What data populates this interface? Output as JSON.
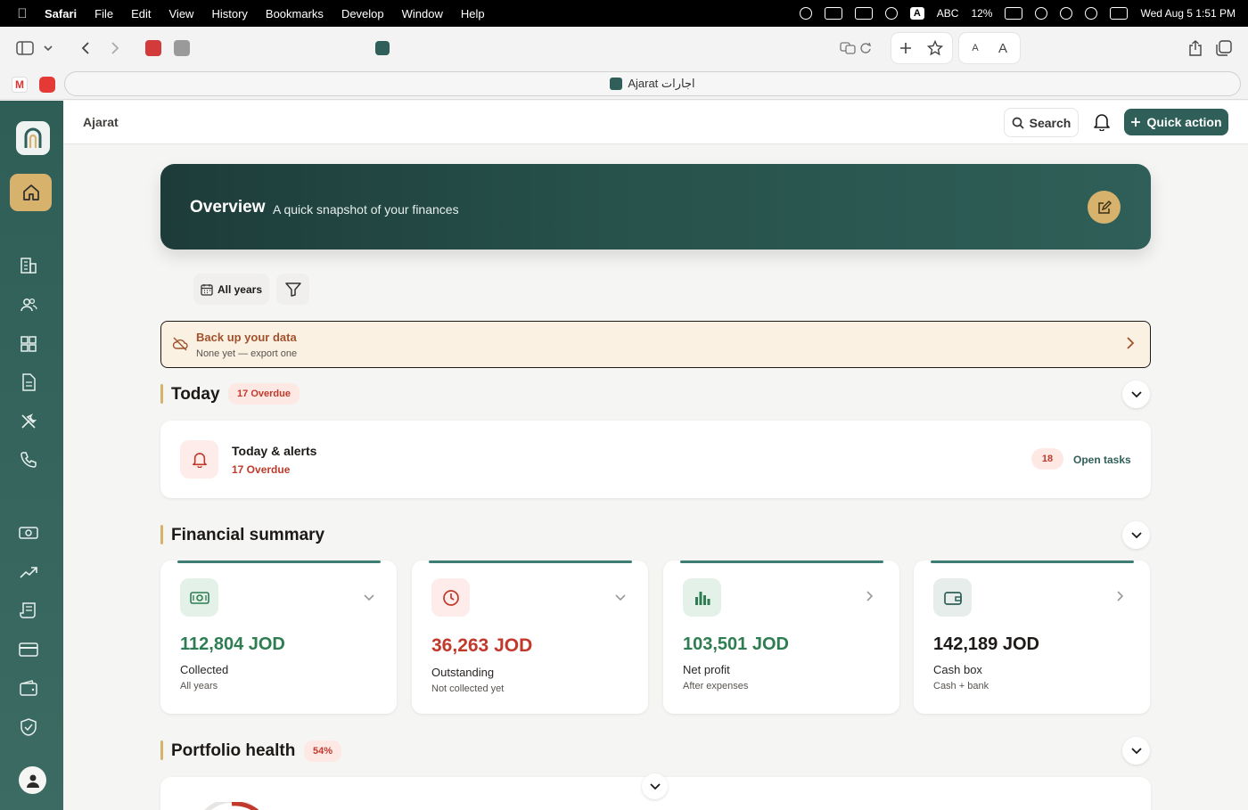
{
  "menubar": {
    "app": "Safari",
    "items": [
      "File",
      "Edit",
      "View",
      "History",
      "Bookmarks",
      "Develop",
      "Window",
      "Help"
    ],
    "input_label": "ABC",
    "battery": "12%",
    "datetime": "Wed Aug 5  1:51 PM"
  },
  "browser": {
    "tab_title": "Ajarat اجارات",
    "text_size_small": "A",
    "text_size_large": "A"
  },
  "app": {
    "brand": "Ajarat",
    "search_label": "Search",
    "quick_action_label": "Quick action",
    "accent": "#2f5f58",
    "gold": "#d6b26c"
  },
  "overview": {
    "title": "Overview",
    "subtitle": "A quick snapshot of your finances"
  },
  "filters": {
    "years_label": "All years"
  },
  "backup": {
    "title": "Back up your data",
    "subtitle": "None yet — export one"
  },
  "today": {
    "title": "Today",
    "badge": "17 Overdue",
    "alerts_title": "Today & alerts",
    "alerts_sub": "17 Overdue",
    "open_count": "18",
    "open_label": "Open tasks"
  },
  "financial": {
    "title": "Financial summary",
    "cards": [
      {
        "value": "112,804 JOD",
        "label": "Collected",
        "sub": "All years",
        "color": "#2e7d52",
        "icon": "money-icon"
      },
      {
        "value": "36,263 JOD",
        "label": "Outstanding",
        "sub": "Not collected yet",
        "color": "#c0392b",
        "icon": "clock-icon"
      },
      {
        "value": "103,501 JOD",
        "label": "Net profit",
        "sub": "After expenses",
        "color": "#2e7d52",
        "icon": "chart-icon"
      },
      {
        "value": "142,189 JOD",
        "label": "Cash box",
        "sub": "Cash + bank",
        "color": "#1c1917",
        "icon": "wallet-icon"
      }
    ]
  },
  "portfolio": {
    "title": "Portfolio health",
    "badge": "54%"
  }
}
